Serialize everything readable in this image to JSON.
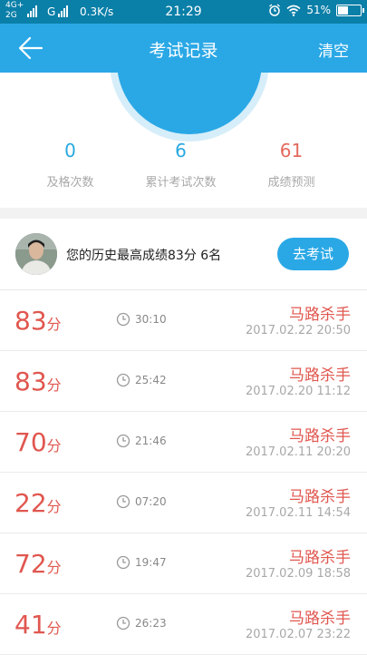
{
  "status_bar": {
    "network_top": "4G+",
    "network_bottom": "2G",
    "network_g": "G",
    "speed": "0.3K/s",
    "time": "21:29",
    "battery": "51%",
    "battery_level": 0.51
  },
  "header": {
    "title": "考试记录",
    "clear_label": "清空",
    "back_icon": "arrow-left-icon"
  },
  "stats": [
    {
      "value": "0",
      "label": "及格次数",
      "color": "#29a8e0"
    },
    {
      "value": "6",
      "label": "累计考试次数",
      "color": "#29a8e0"
    },
    {
      "value": "61",
      "label": "成绩预测",
      "color": "#e46a5e"
    }
  ],
  "best": {
    "text": "您的历史最高成绩83分  6名",
    "button_label": "去考试"
  },
  "records": [
    {
      "score": "83",
      "unit": "分",
      "duration": "30:10",
      "name": "马路杀手",
      "date": "2017.02.22  20:50"
    },
    {
      "score": "83",
      "unit": "分",
      "duration": "25:42",
      "name": "马路杀手",
      "date": "2017.02.20  11:12"
    },
    {
      "score": "70",
      "unit": "分",
      "duration": "21:46",
      "name": "马路杀手",
      "date": "2017.02.11  20:20"
    },
    {
      "score": "22",
      "unit": "分",
      "duration": "07:20",
      "name": "马路杀手",
      "date": "2017.02.11  14:54"
    },
    {
      "score": "72",
      "unit": "分",
      "duration": "19:47",
      "name": "马路杀手",
      "date": "2017.02.09  18:58"
    },
    {
      "score": "41",
      "unit": "分",
      "duration": "26:23",
      "name": "马路杀手",
      "date": "2017.02.07  23:22"
    }
  ],
  "colors": {
    "accent": "#2aa8e6",
    "score": "#e0574f",
    "status_bar": "#0a7fa8"
  }
}
